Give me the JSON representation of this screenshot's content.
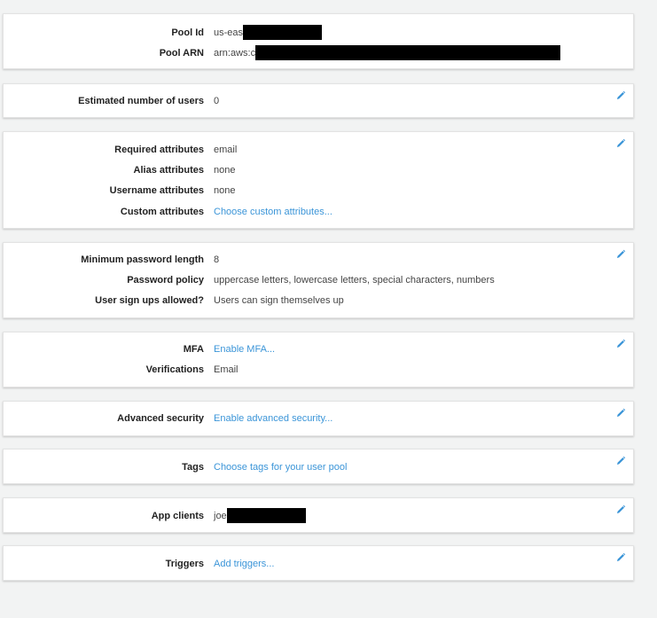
{
  "pool": {
    "id_label": "Pool Id",
    "id_value": "us-eas",
    "arn_label": "Pool ARN",
    "arn_value": "arn:aws:c"
  },
  "users": {
    "label": "Estimated number of users",
    "value": "0"
  },
  "attributes": {
    "required_label": "Required attributes",
    "required_value": "email",
    "alias_label": "Alias attributes",
    "alias_value": "none",
    "username_label": "Username attributes",
    "username_value": "none",
    "custom_label": "Custom attributes",
    "custom_link": "Choose custom attributes..."
  },
  "password": {
    "min_label": "Minimum password length",
    "min_value": "8",
    "policy_label": "Password policy",
    "policy_value": "uppercase letters, lowercase letters, special characters, numbers",
    "signup_label": "User sign ups allowed?",
    "signup_value": "Users can sign themselves up"
  },
  "mfa": {
    "mfa_label": "MFA",
    "mfa_link": "Enable MFA...",
    "verif_label": "Verifications",
    "verif_value": "Email"
  },
  "security": {
    "label": "Advanced security",
    "link": "Enable advanced security..."
  },
  "tags": {
    "label": "Tags",
    "link": "Choose tags for your user pool"
  },
  "clients": {
    "label": "App clients",
    "value": "joe"
  },
  "triggers": {
    "label": "Triggers",
    "link": "Add triggers..."
  },
  "colors": {
    "link": "#3b95d8",
    "page_bg": "#f2f3f3",
    "panel_bg": "#ffffff",
    "edit_icon": "#3b95d8"
  },
  "icons": {
    "edit": "pencil-icon"
  }
}
